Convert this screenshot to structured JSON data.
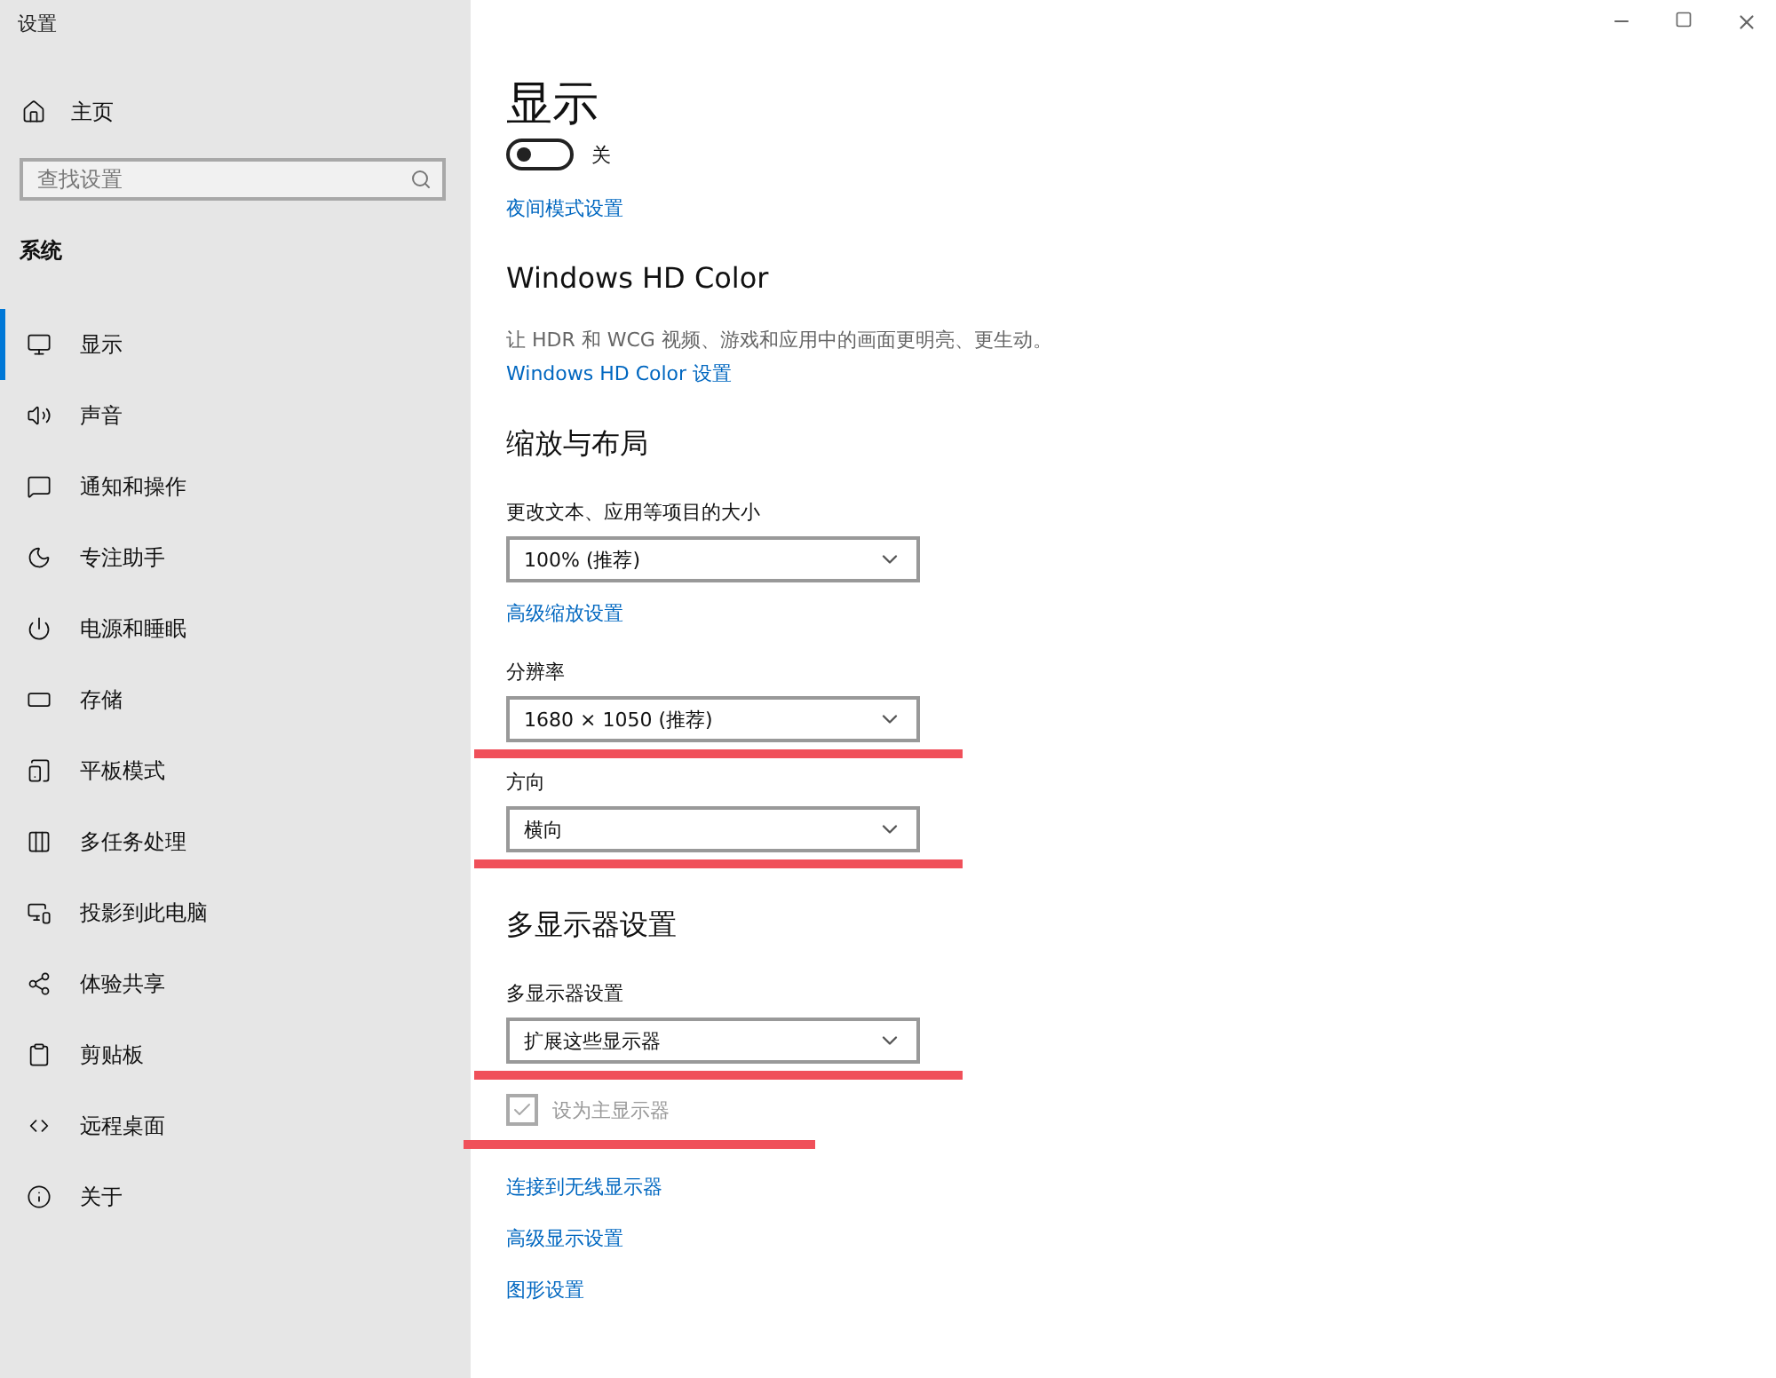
{
  "window": {
    "title": "设置"
  },
  "sidebar": {
    "home": "主页",
    "search": {
      "placeholder": "查找设置"
    },
    "section": "系统",
    "items": [
      {
        "label": "显示",
        "selected": true
      },
      {
        "label": "声音",
        "selected": false
      },
      {
        "label": "通知和操作",
        "selected": false
      },
      {
        "label": "专注助手",
        "selected": false
      },
      {
        "label": "电源和睡眠",
        "selected": false
      },
      {
        "label": "存储",
        "selected": false
      },
      {
        "label": "平板模式",
        "selected": false
      },
      {
        "label": "多任务处理",
        "selected": false
      },
      {
        "label": "投影到此电脑",
        "selected": false
      },
      {
        "label": "体验共享",
        "selected": false
      },
      {
        "label": "剪贴板",
        "selected": false
      },
      {
        "label": "远程桌面",
        "selected": false
      },
      {
        "label": "关于",
        "selected": false
      }
    ]
  },
  "main": {
    "title": "显示",
    "items": [
      {
        "kind": "toggle",
        "on": false,
        "label": "关"
      },
      {
        "kind": "link",
        "text": "夜间模式设置"
      },
      {
        "kind": "heading",
        "text": "Windows HD Color"
      },
      {
        "kind": "text",
        "text": "让 HDR 和 WCG 视频、游戏和应用中的画面更明亮、更生动。"
      },
      {
        "kind": "link",
        "text": "Windows HD Color 设置"
      },
      {
        "kind": "heading",
        "text": "缩放与布局"
      },
      {
        "kind": "label",
        "text": "更改文本、应用等项目的大小"
      },
      {
        "kind": "dropdown",
        "value": "100% (推荐)"
      },
      {
        "kind": "link",
        "text": "高级缩放设置"
      },
      {
        "kind": "label",
        "text": "分辨率"
      },
      {
        "kind": "dropdown",
        "value": "1680 × 1050 (推荐)",
        "underlined": true
      },
      {
        "kind": "label",
        "text": "方向"
      },
      {
        "kind": "dropdown",
        "value": "横向",
        "underlined": true
      },
      {
        "kind": "heading",
        "text": "多显示器设置"
      },
      {
        "kind": "label",
        "text": "多显示器设置"
      },
      {
        "kind": "dropdown",
        "value": "扩展这些显示器",
        "underlined": true
      },
      {
        "kind": "checkbox",
        "text": "设为主显示器",
        "checked": true,
        "disabled": true,
        "underlined": true
      },
      {
        "kind": "link",
        "text": "连接到无线显示器"
      },
      {
        "kind": "link",
        "text": "高级显示设置"
      },
      {
        "kind": "link",
        "text": "图形设置"
      }
    ]
  }
}
